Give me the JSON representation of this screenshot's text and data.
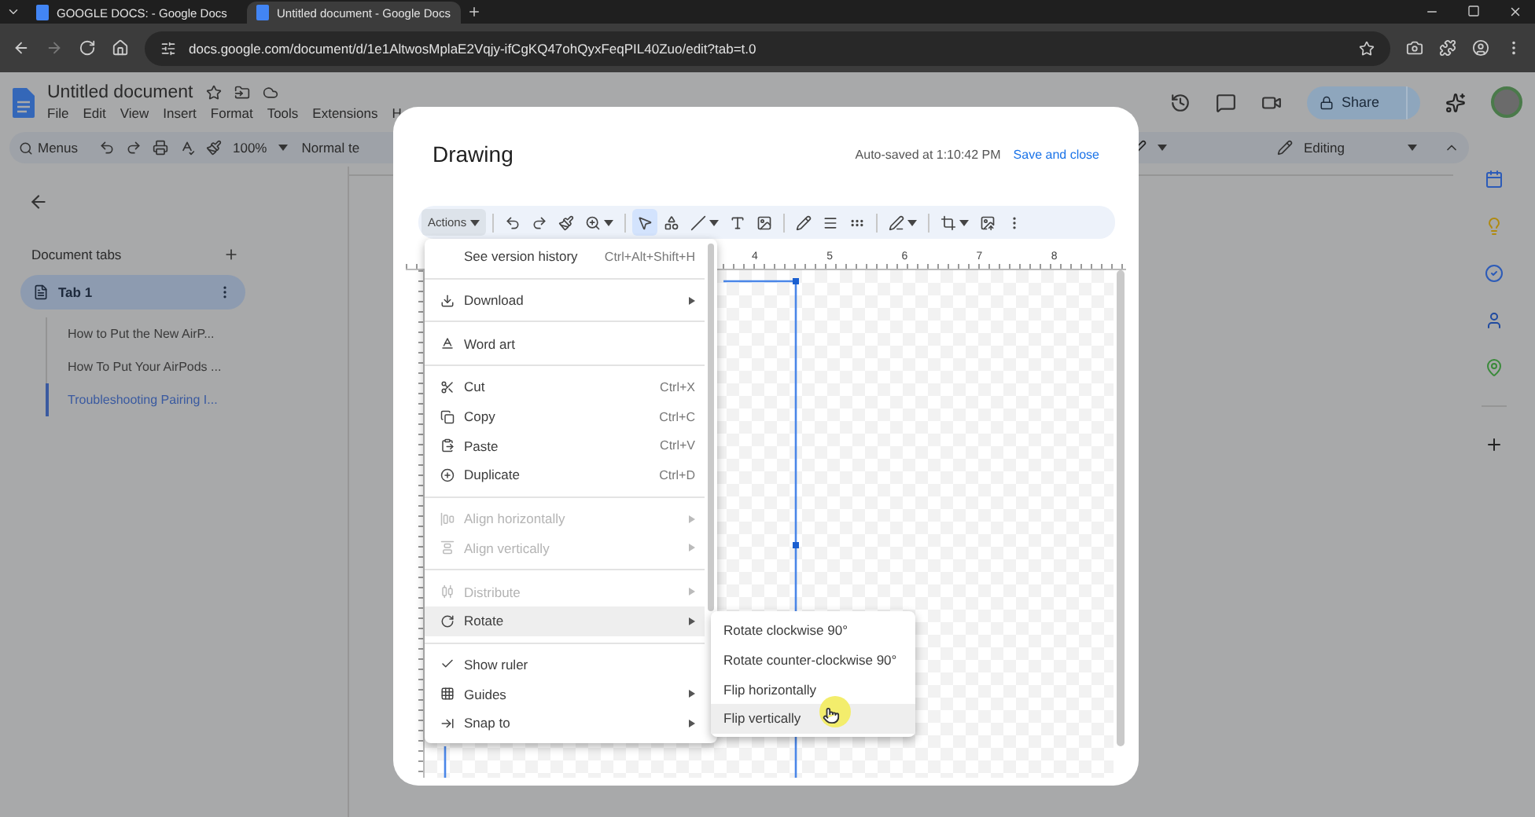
{
  "browser": {
    "tabs": [
      {
        "title": "GOOGLE DOCS: - Google Docs",
        "selected": false
      },
      {
        "title": "Untitled document - Google Docs",
        "selected": true
      }
    ],
    "url": "docs.google.com/document/d/1e1AltwosMplaE2Vqjy-ifCgKQ47ohQyxFeqPIL40Zuo/edit?tab=t.0"
  },
  "document": {
    "title": "Untitled document",
    "menu": [
      "File",
      "Edit",
      "View",
      "Insert",
      "Format",
      "Tools",
      "Extensions",
      "H"
    ],
    "share_label": "Share"
  },
  "toolbar": {
    "search_label": "Menus",
    "zoom": "100%",
    "style": "Normal te",
    "mode": "Editing"
  },
  "sidebar": {
    "heading": "Document tabs",
    "tabs": [
      {
        "label": "Tab 1",
        "selected": true,
        "children": [
          {
            "label": "How to Put the New AirP...",
            "selected": false
          },
          {
            "label": "How To Put Your AirPods ...",
            "selected": false
          },
          {
            "label": "Troubleshooting Pairing I...",
            "selected": true
          }
        ]
      }
    ]
  },
  "dialog": {
    "title": "Drawing",
    "status": "Auto-saved at 1:10:42 PM",
    "save_label": "Save and close",
    "toolbar": {
      "menu_button": "Actions",
      "tools": [
        {
          "selected": false,
          "has_caret": false
        },
        {
          "selected": false,
          "has_caret": false
        },
        {
          "selected": false,
          "has_caret": false
        },
        {
          "selected": false,
          "has_caret": true
        },
        {
          "selected": true,
          "has_caret": false
        },
        {
          "selected": false,
          "has_caret": false
        },
        {
          "selected": false,
          "has_caret": true
        },
        {
          "selected": false,
          "has_caret": false
        },
        {
          "selected": false,
          "has_caret": false
        },
        {
          "selected": false,
          "has_caret": false
        },
        {
          "selected": false,
          "has_caret": false
        },
        {
          "selected": false,
          "has_caret": false
        },
        {
          "selected": false,
          "has_caret": true
        },
        {
          "selected": false,
          "has_caret": true
        },
        {
          "selected": false,
          "has_caret": false
        },
        {
          "selected": false,
          "has_caret": false
        }
      ]
    },
    "ruler": [
      "4",
      "5",
      "6",
      "7",
      "8"
    ],
    "actions_menu": {
      "sections": [
        [
          {
            "label": "See version history",
            "shortcut": "Ctrl+Alt+Shift+H",
            "has_submenu": false,
            "disabled": false,
            "checked": false,
            "selected": false
          }
        ],
        [
          {
            "label": "Download",
            "has_submenu": true,
            "disabled": false,
            "checked": false,
            "selected": false
          }
        ],
        [
          {
            "label": "Word art",
            "has_submenu": false,
            "disabled": false,
            "checked": false,
            "selected": false
          }
        ],
        [
          {
            "label": "Cut",
            "shortcut": "Ctrl+X",
            "has_submenu": false,
            "disabled": false,
            "checked": false,
            "selected": false
          },
          {
            "label": "Copy",
            "shortcut": "Ctrl+C",
            "has_submenu": false,
            "disabled": false,
            "checked": false,
            "selected": false
          },
          {
            "label": "Paste",
            "shortcut": "Ctrl+V",
            "has_submenu": false,
            "disabled": false,
            "checked": false,
            "selected": false
          },
          {
            "label": "Duplicate",
            "shortcut": "Ctrl+D",
            "has_submenu": false,
            "disabled": false,
            "checked": false,
            "selected": false
          }
        ],
        [
          {
            "label": "Align horizontally",
            "has_submenu": true,
            "disabled": true,
            "checked": false,
            "selected": false
          },
          {
            "label": "Align vertically",
            "has_submenu": true,
            "disabled": true,
            "checked": false,
            "selected": false
          }
        ],
        [
          {
            "label": "Distribute",
            "has_submenu": true,
            "disabled": true,
            "checked": false,
            "selected": false
          },
          {
            "label": "Rotate",
            "has_submenu": true,
            "disabled": false,
            "checked": false,
            "selected": true
          }
        ],
        [
          {
            "label": "Show ruler",
            "has_submenu": false,
            "disabled": false,
            "checked": true,
            "selected": false
          },
          {
            "label": "Guides",
            "has_submenu": true,
            "disabled": false,
            "checked": false,
            "selected": false
          },
          {
            "label": "Snap to",
            "has_submenu": true,
            "disabled": false,
            "checked": false,
            "selected": false
          }
        ]
      ]
    },
    "submenu": {
      "items": [
        {
          "label": "Rotate clockwise 90°",
          "selected": false
        },
        {
          "label": "Rotate counter-clockwise 90°",
          "selected": false
        },
        {
          "label": "Flip horizontally",
          "selected": false
        },
        {
          "label": "Flip vertically",
          "selected": true
        }
      ]
    }
  }
}
